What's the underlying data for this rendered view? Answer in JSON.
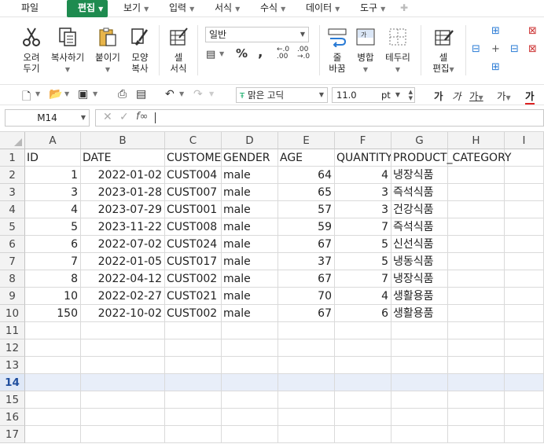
{
  "menu": {
    "file": "파일",
    "edit": "편집",
    "view": "보기",
    "insert": "입력",
    "format": "서식",
    "formula": "수식",
    "data": "데이터",
    "tools": "도구"
  },
  "ribbon": {
    "cut": [
      "오려",
      "두기"
    ],
    "copy": "복사하기",
    "paste": "붙이기",
    "format_painter": [
      "모양",
      "복사"
    ],
    "cell_format": [
      "셀",
      "서식"
    ],
    "number_format": "일반",
    "wrap": [
      "줄",
      "바꿈"
    ],
    "merge": "병합",
    "borders": "테두리",
    "cell_edit": [
      "셀",
      "편집"
    ]
  },
  "toolbar": {
    "font": "맑은 고딕",
    "font_size": "11.0",
    "size_unit": "pt",
    "bold_sample": "가",
    "italic_sample": "가",
    "underline_sample": "가",
    "style_sample": "가",
    "color_sample": "가"
  },
  "formula_bar": {
    "name_box": "M14",
    "formula": ""
  },
  "sheet": {
    "columns": [
      "A",
      "B",
      "C",
      "D",
      "E",
      "F",
      "G",
      "H",
      "I"
    ],
    "header_row": [
      "ID",
      "DATE",
      "CUSTOMER_ID",
      "GENDER",
      "AGE",
      "QUANTITY",
      "PRODUCT_CATEGORY",
      "",
      ""
    ],
    "rows": [
      [
        "1",
        "2022-01-02",
        "CUST004",
        "male",
        "64",
        "4",
        "냉장식품"
      ],
      [
        "3",
        "2023-01-28",
        "CUST007",
        "male",
        "65",
        "3",
        "즉석식품"
      ],
      [
        "4",
        "2023-07-29",
        "CUST001",
        "male",
        "57",
        "3",
        "건강식품"
      ],
      [
        "5",
        "2023-11-22",
        "CUST008",
        "male",
        "59",
        "7",
        "즉석식품"
      ],
      [
        "6",
        "2022-07-02",
        "CUST024",
        "male",
        "67",
        "5",
        "신선식품"
      ],
      [
        "7",
        "2022-01-05",
        "CUST017",
        "male",
        "37",
        "5",
        "냉동식품"
      ],
      [
        "8",
        "2022-04-12",
        "CUST002",
        "male",
        "67",
        "7",
        "냉장식품"
      ],
      [
        "10",
        "2022-02-27",
        "CUST021",
        "male",
        "70",
        "4",
        "생활용품"
      ],
      [
        "150",
        "2022-10-02",
        "CUST002",
        "male",
        "67",
        "6",
        "생활용품"
      ]
    ],
    "row_numbers": [
      "1",
      "2",
      "3",
      "4",
      "5",
      "6",
      "7",
      "8",
      "9",
      "10",
      "11",
      "12",
      "13",
      "14",
      "15",
      "16",
      "17"
    ],
    "selected_row": "14"
  }
}
